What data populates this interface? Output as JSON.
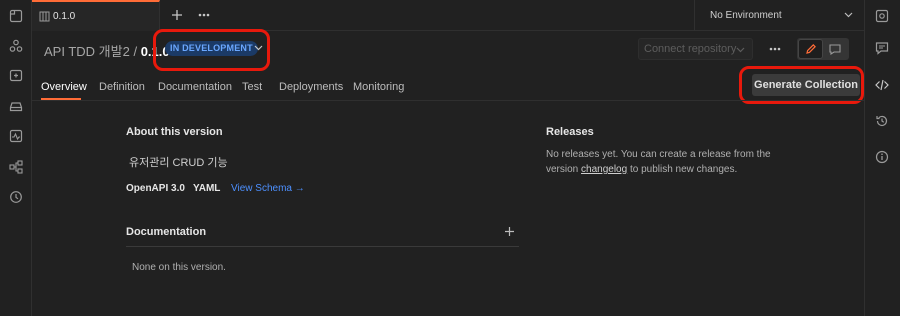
{
  "tab": {
    "label": "0.1.0"
  },
  "environment": {
    "label": "No Environment"
  },
  "header": {
    "api_name": "API TDD 개발2",
    "separator": "/",
    "version": "0.1.0",
    "status_badge": "IN DEVELOPMENT",
    "connect_repository": "Connect repository",
    "generate_collection": "Generate Collection"
  },
  "subtabs": [
    "Overview",
    "Definition",
    "Documentation",
    "Test",
    "Deployments",
    "Monitoring"
  ],
  "about": {
    "title": "About this version",
    "description": "유저관리 CRUD 기능",
    "format": "OpenAPI 3.0",
    "syntax": "YAML",
    "view_schema": "View Schema →"
  },
  "documentation": {
    "title": "Documentation",
    "empty": "None on this version."
  },
  "releases": {
    "title": "Releases",
    "line1": "No releases yet. You can create a release from the",
    "line2_prefix": "version ",
    "line2_link": "changelog",
    "line2_suffix": " to publish new changes."
  },
  "colors": {
    "accent": "#ff6c37",
    "badge_bg": "#1b3a66",
    "badge_text": "#6aa7ff",
    "link": "#4d90fe",
    "highlight_ring": "#e8190c"
  }
}
